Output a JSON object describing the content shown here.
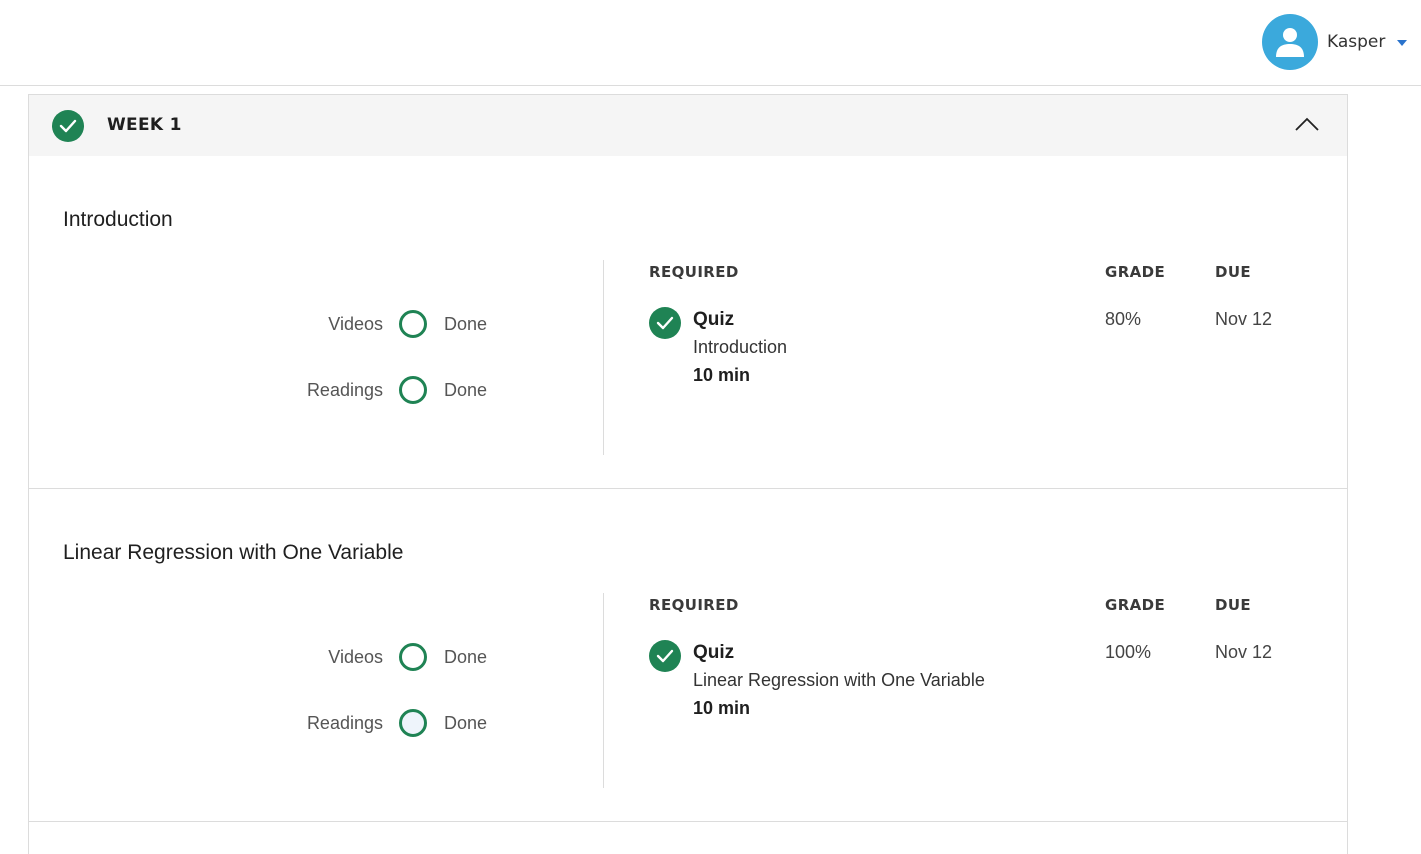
{
  "header": {
    "user_name": "Kasper"
  },
  "week": {
    "title": "WEEK 1",
    "completed": true,
    "colors": {
      "success": "#1f8354",
      "avatar": "#3ba9dc",
      "caret": "#2a73cc"
    },
    "lessons": [
      {
        "title": "Introduction",
        "progress": [
          {
            "label": "Videos",
            "status": "Done"
          },
          {
            "label": "Readings",
            "status": "Done"
          }
        ],
        "columns": {
          "required": "REQUIRED",
          "grade": "GRADE",
          "due": "DUE"
        },
        "item": {
          "type": "Quiz",
          "name": "Introduction",
          "duration": "10 min",
          "grade": "80%",
          "due": "Nov 12",
          "completed": true
        }
      },
      {
        "title": "Linear Regression with One Variable",
        "progress": [
          {
            "label": "Videos",
            "status": "Done"
          },
          {
            "label": "Readings",
            "status": "Done"
          }
        ],
        "columns": {
          "required": "REQUIRED",
          "grade": "GRADE",
          "due": "DUE"
        },
        "item": {
          "type": "Quiz",
          "name": "Linear Regression with One Variable",
          "duration": "10 min",
          "grade": "100%",
          "due": "Nov 12",
          "completed": true
        }
      }
    ]
  },
  "icons": [
    "user-avatar-icon",
    "dropdown-caret-icon",
    "check-circle-icon",
    "chevron-up-icon",
    "progress-ring-icon"
  ]
}
